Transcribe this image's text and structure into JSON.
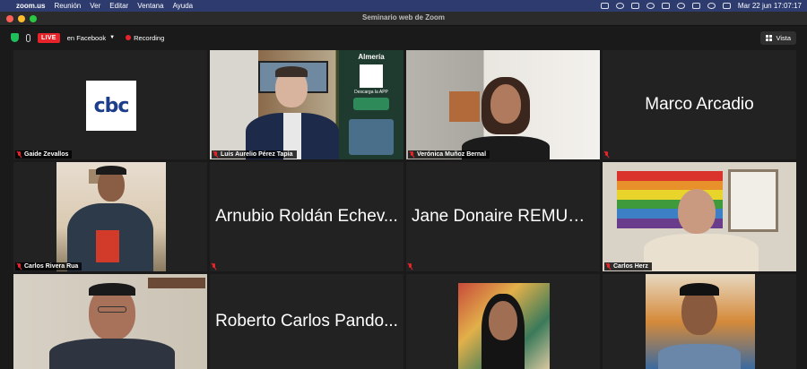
{
  "menubar": {
    "app": "zoom.us",
    "menus": [
      "Reunión",
      "Ver",
      "Editar",
      "Ventana",
      "Ayuda"
    ],
    "clock": "Mar 22 jun  17:07:17"
  },
  "window": {
    "title": "Seminario web de Zoom"
  },
  "toolbar": {
    "live_label": "LIVE",
    "live_target": "en Facebook",
    "recording_label": "Recording",
    "view_label": "Vista"
  },
  "colors": {
    "live": "#e8242a",
    "active_speaker": "#c9e23b",
    "shield": "#1fbf5b"
  },
  "participants": [
    {
      "name": "Gaide Zevallos",
      "video": "logo"
    },
    {
      "name": "Luis Aurelio Pérez Tapia",
      "video": "camera"
    },
    {
      "name": "Verónica Muñoz Bernal",
      "video": "camera"
    },
    {
      "name": "Marco Arcadio",
      "video": "off"
    },
    {
      "name": "Carlos Rivera Rua",
      "video": "camera"
    },
    {
      "name": "Arnubio Roldán Echev...",
      "video": "off"
    },
    {
      "name": "Jane Donaire REMURPE",
      "video": "off"
    },
    {
      "name": "Carlos Herz",
      "video": "camera"
    },
    {
      "name": "",
      "video": "camera",
      "active": true
    },
    {
      "name": "Roberto Carlos Pando...",
      "video": "off"
    },
    {
      "name": "",
      "video": "camera"
    },
    {
      "name": "",
      "video": "camera"
    }
  ],
  "logo_text": "cbc",
  "banner": {
    "title": "Almería",
    "app_prompt": "Descarga la APP"
  }
}
